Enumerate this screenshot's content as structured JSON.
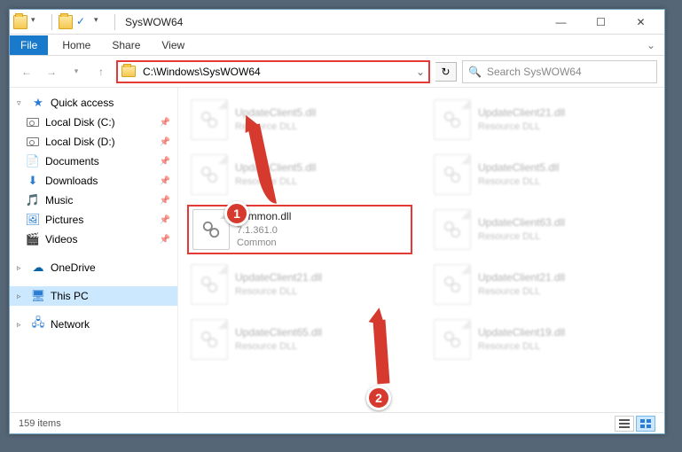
{
  "window": {
    "title": "SysWOW64"
  },
  "qat": {
    "down_glyph": "▾",
    "check_glyph": "✓"
  },
  "ribbon": {
    "file": "File",
    "tabs": [
      "Home",
      "Share",
      "View"
    ],
    "expand_glyph": "⌄"
  },
  "nav_buttons": {
    "back_glyph": "←",
    "fwd_glyph": "→",
    "dd_glyph": "▾",
    "up_glyph": "↑"
  },
  "address": {
    "path": "C:\\Windows\\SysWOW64",
    "dd_glyph": "⌄",
    "refresh_glyph": "↻"
  },
  "search": {
    "icon": "🔍",
    "placeholder": "Search SysWOW64"
  },
  "sidebar": {
    "quick": {
      "label": "Quick access",
      "star": "★",
      "chv": "▿",
      "items": [
        {
          "icon": "disk",
          "label": "Local Disk (C:)",
          "pin": "📌"
        },
        {
          "icon": "disk",
          "label": "Local Disk (D:)",
          "pin": "📌"
        },
        {
          "icon": "📄",
          "label": "Documents",
          "pin": "📌"
        },
        {
          "icon": "⬇",
          "label": "Downloads",
          "pin": "📌"
        },
        {
          "icon": "🎵",
          "label": "Music",
          "pin": "📌"
        },
        {
          "icon": "🖼",
          "label": "Pictures",
          "pin": "📌"
        },
        {
          "icon": "🎬",
          "label": "Videos",
          "pin": "📌"
        }
      ]
    },
    "onedrive": {
      "icon": "☁",
      "label": "OneDrive",
      "chv": "▹"
    },
    "thispc": {
      "icon": "🖥",
      "label": "This PC",
      "chv": "▹"
    },
    "network": {
      "icon": "🖧",
      "label": "Network",
      "chv": "▹"
    }
  },
  "files_bg": [
    {
      "name": "UpdateClient5.dll",
      "sub": "Resource DLL"
    },
    {
      "name": "UpdateClient21.dll",
      "sub": "Resource DLL"
    },
    {
      "name": "UpdateClient5.dll",
      "sub": "Resource DLL"
    },
    {
      "name": "UpdateClient5.dll",
      "sub": "Resource DLL"
    },
    {
      "name": "",
      "sub": ""
    },
    {
      "name": "UpdateClient63.dll",
      "sub": "Resource DLL"
    },
    {
      "name": "UpdateClient21.dll",
      "sub": "Resource DLL"
    },
    {
      "name": "UpdateClient21.dll",
      "sub": "Resource DLL"
    },
    {
      "name": "UpdateClient65.dll",
      "sub": "Resource DLL"
    },
    {
      "name": "UpdateClient19.dll",
      "sub": "Resource DLL"
    }
  ],
  "highlight_file": {
    "name": "common.dll",
    "version": "7.1.361.0",
    "desc": "Common"
  },
  "callouts": {
    "one": "1",
    "two": "2"
  },
  "status": {
    "count": "159 items"
  },
  "win_controls": {
    "min": "—",
    "max": "☐",
    "close": "✕"
  }
}
